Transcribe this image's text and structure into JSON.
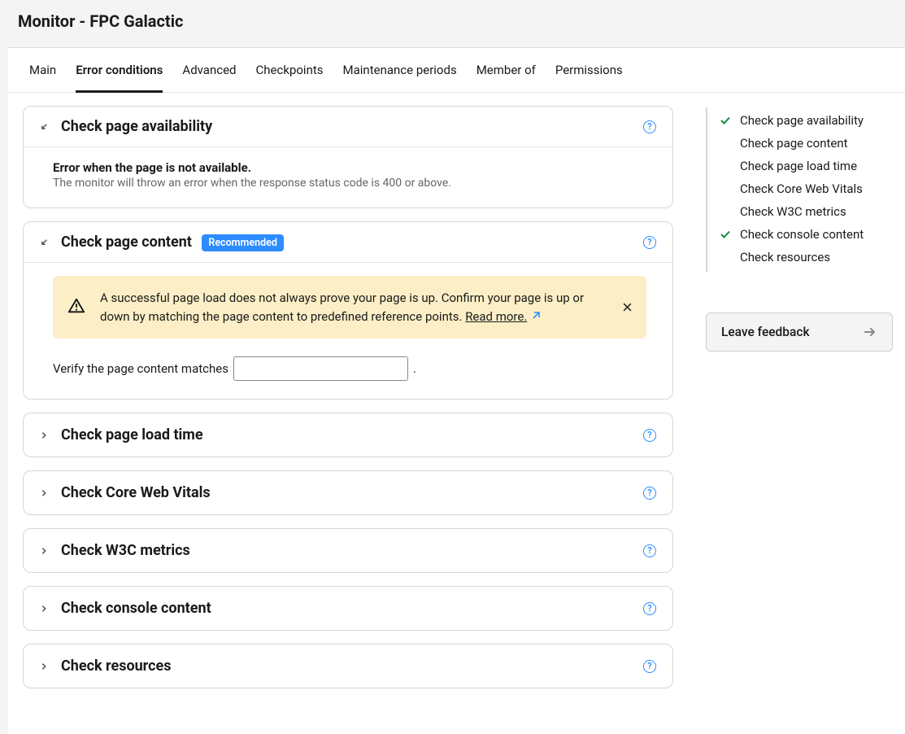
{
  "page": {
    "title": "Monitor - FPC Galactic"
  },
  "tabs": [
    {
      "label": "Main",
      "active": false
    },
    {
      "label": "Error conditions",
      "active": true
    },
    {
      "label": "Advanced",
      "active": false
    },
    {
      "label": "Checkpoints",
      "active": false
    },
    {
      "label": "Maintenance periods",
      "active": false
    },
    {
      "label": "Member of",
      "active": false
    },
    {
      "label": "Permissions",
      "active": false
    }
  ],
  "sections": {
    "availability": {
      "title": "Check page availability",
      "expanded": true,
      "error_heading": "Error when the page is not available.",
      "error_sub": "The monitor will throw an error when the response status code is 400 or above."
    },
    "content": {
      "title": "Check page content",
      "badge": "Recommended",
      "expanded": true,
      "alert_text": "A successful page load does not always prove your page is up. Confirm your page is up or down by matching the page content to predefined reference points. ",
      "readmore": "Read more.",
      "verify_label_pre": "Verify the page content matches",
      "verify_value": "",
      "verify_label_post": "."
    },
    "loadtime": {
      "title": "Check page load time",
      "expanded": false
    },
    "cwv": {
      "title": "Check Core Web Vitals",
      "expanded": false
    },
    "w3c": {
      "title": "Check W3C metrics",
      "expanded": false
    },
    "console": {
      "title": "Check console content",
      "expanded": false
    },
    "resources": {
      "title": "Check resources",
      "expanded": false
    }
  },
  "sidenav": [
    {
      "label": "Check page availability",
      "checked": true
    },
    {
      "label": "Check page content",
      "checked": false
    },
    {
      "label": "Check page load time",
      "checked": false
    },
    {
      "label": "Check Core Web Vitals",
      "checked": false
    },
    {
      "label": "Check W3C metrics",
      "checked": false
    },
    {
      "label": "Check console content",
      "checked": true
    },
    {
      "label": "Check resources",
      "checked": false
    }
  ],
  "feedback": {
    "label": "Leave feedback"
  }
}
